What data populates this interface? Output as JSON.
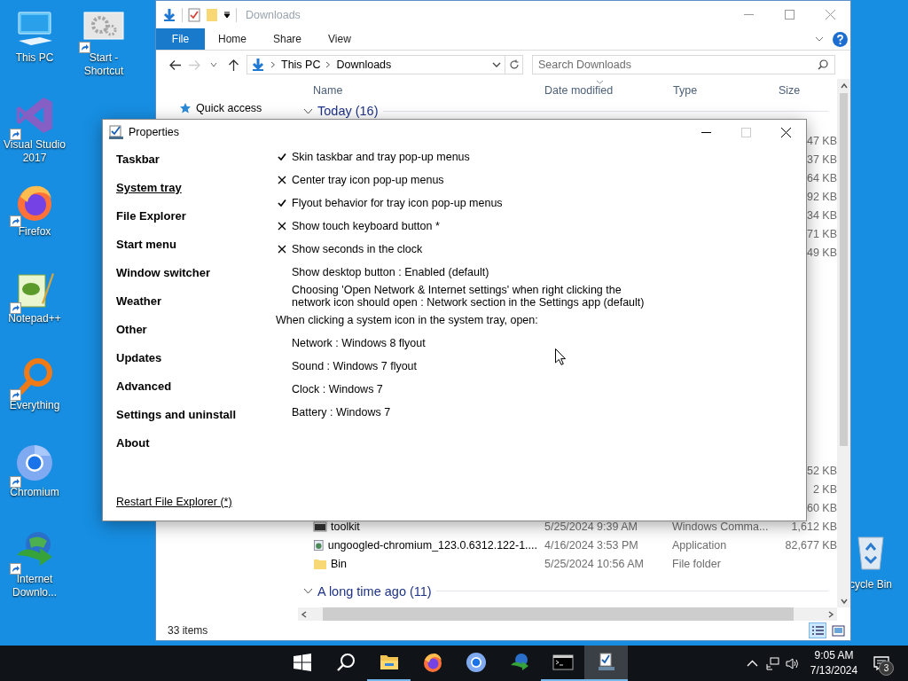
{
  "desktop_icons": [
    {
      "label": "This PC",
      "kind": "pc",
      "shortcut": false
    },
    {
      "label": "Visual Studio 2017",
      "kind": "visual-studio",
      "shortcut": true
    },
    {
      "label": "Firefox",
      "kind": "firefox",
      "shortcut": true
    },
    {
      "label": "Notepad++",
      "kind": "notepad",
      "shortcut": true
    },
    {
      "label": "Everything",
      "kind": "magnifier",
      "shortcut": true
    },
    {
      "label": "Chromium",
      "kind": "chromium",
      "shortcut": true
    },
    {
      "label": "Internet Downlo...",
      "kind": "globe",
      "shortcut": true
    },
    {
      "label": "Start - Shortcut",
      "kind": "gears",
      "shortcut": true
    }
  ],
  "recycle_bin": {
    "label": "cycle Bin"
  },
  "explorer": {
    "title": "Downloads",
    "ribbon_tabs": [
      {
        "label": "File",
        "kind": "file"
      },
      {
        "label": "Home",
        "kind": "tab"
      },
      {
        "label": "Share",
        "kind": "tab"
      },
      {
        "label": "View",
        "kind": "tab"
      }
    ],
    "address": {
      "path": [
        "This PC",
        "Downloads"
      ]
    },
    "search": {
      "placeholder": "Search Downloads"
    },
    "nav": [
      {
        "label": "Quick access"
      }
    ],
    "columns": [
      {
        "label": "Name",
        "sorted": false
      },
      {
        "label": "Date modified",
        "sorted": true
      },
      {
        "label": "Type",
        "sorted": false
      },
      {
        "label": "Size",
        "sorted": false
      }
    ],
    "groups": [
      {
        "label": "Today (16)",
        "rows": [
          {
            "size": "47 KB"
          },
          {
            "size": "37 KB"
          },
          {
            "size": "64 KB"
          },
          {
            "size": "92 KB"
          },
          {
            "size": "34 KB"
          },
          {
            "size": "71 KB"
          },
          {
            "size": "49 KB"
          },
          {
            "size": "52 KB"
          },
          {
            "size": "2 KB"
          },
          {
            "size": "60 KB"
          },
          {
            "kind": "script",
            "name": "toolkit",
            "date": "5/25/2024 9:39 AM",
            "type": "Windows Comma...",
            "size": "1,612 KB"
          },
          {
            "kind": "app",
            "name": "ungoogled-chromium_123.0.6312.122-1....",
            "date": "4/16/2024 3:53 PM",
            "type": "Application",
            "size": "82,677 KB"
          },
          {
            "kind": "folder",
            "name": "Bin",
            "date": "5/25/2024 10:56 AM",
            "type": "File folder"
          }
        ]
      },
      {
        "label": "A long time ago (11)"
      }
    ],
    "status": "33 items"
  },
  "properties": {
    "title": "Properties",
    "can_maximize": false,
    "nav": [
      {
        "label": "Taskbar",
        "selected": false
      },
      {
        "label": "System tray",
        "selected": true
      },
      {
        "label": "File Explorer",
        "selected": false
      },
      {
        "label": "Start menu",
        "selected": false
      },
      {
        "label": "Window switcher",
        "selected": false
      },
      {
        "label": "Weather",
        "selected": false
      },
      {
        "label": "Other",
        "selected": false
      },
      {
        "label": "Updates",
        "selected": false
      },
      {
        "label": "Advanced",
        "selected": false
      },
      {
        "label": "Settings and uninstall",
        "selected": false
      },
      {
        "label": "About",
        "selected": false
      }
    ],
    "settings": [
      {
        "kind": "toggle",
        "text": "Skin taskbar and tray pop-up menus",
        "checked": true
      },
      {
        "kind": "toggle",
        "text": "Center tray icon pop-up menus",
        "checked": false
      },
      {
        "kind": "toggle",
        "text": "Flyout behavior for tray icon pop-up menus",
        "checked": true
      },
      {
        "kind": "toggle",
        "text": "Show touch keyboard button *",
        "checked": false
      },
      {
        "kind": "toggle",
        "text": "Show seconds in the clock",
        "checked": false
      },
      {
        "kind": "value",
        "text": "Show desktop button : Enabled (default)"
      },
      {
        "kind": "value",
        "text": "Choosing 'Open Network & Internet settings' when right clicking the network icon should open : Network section in the Settings app (default)"
      },
      {
        "kind": "heading",
        "text": "When clicking a system icon in the system tray, open:"
      },
      {
        "kind": "value",
        "text": "Network : Windows 8 flyout"
      },
      {
        "kind": "value",
        "text": "Sound : Windows 7 flyout"
      },
      {
        "kind": "value",
        "text": "Clock : Windows 7"
      },
      {
        "kind": "value",
        "text": "Battery : Windows 7"
      }
    ],
    "footer_link": "Restart File Explorer (*)"
  },
  "taskbar": {
    "apps": [
      {
        "kind": "start",
        "running": false,
        "active": false
      },
      {
        "kind": "search",
        "running": false,
        "active": false
      },
      {
        "kind": "explorer",
        "running": true,
        "active": false
      },
      {
        "kind": "firefox",
        "running": false,
        "active": false
      },
      {
        "kind": "chromium",
        "running": false,
        "active": false
      },
      {
        "kind": "globe",
        "running": false,
        "active": false
      },
      {
        "kind": "console",
        "running": true,
        "active": false
      },
      {
        "kind": "properties",
        "running": true,
        "active": true
      }
    ],
    "clock": {
      "time": "9:05 AM",
      "date": "7/13/2024"
    },
    "notifications": {
      "count": "3"
    }
  }
}
